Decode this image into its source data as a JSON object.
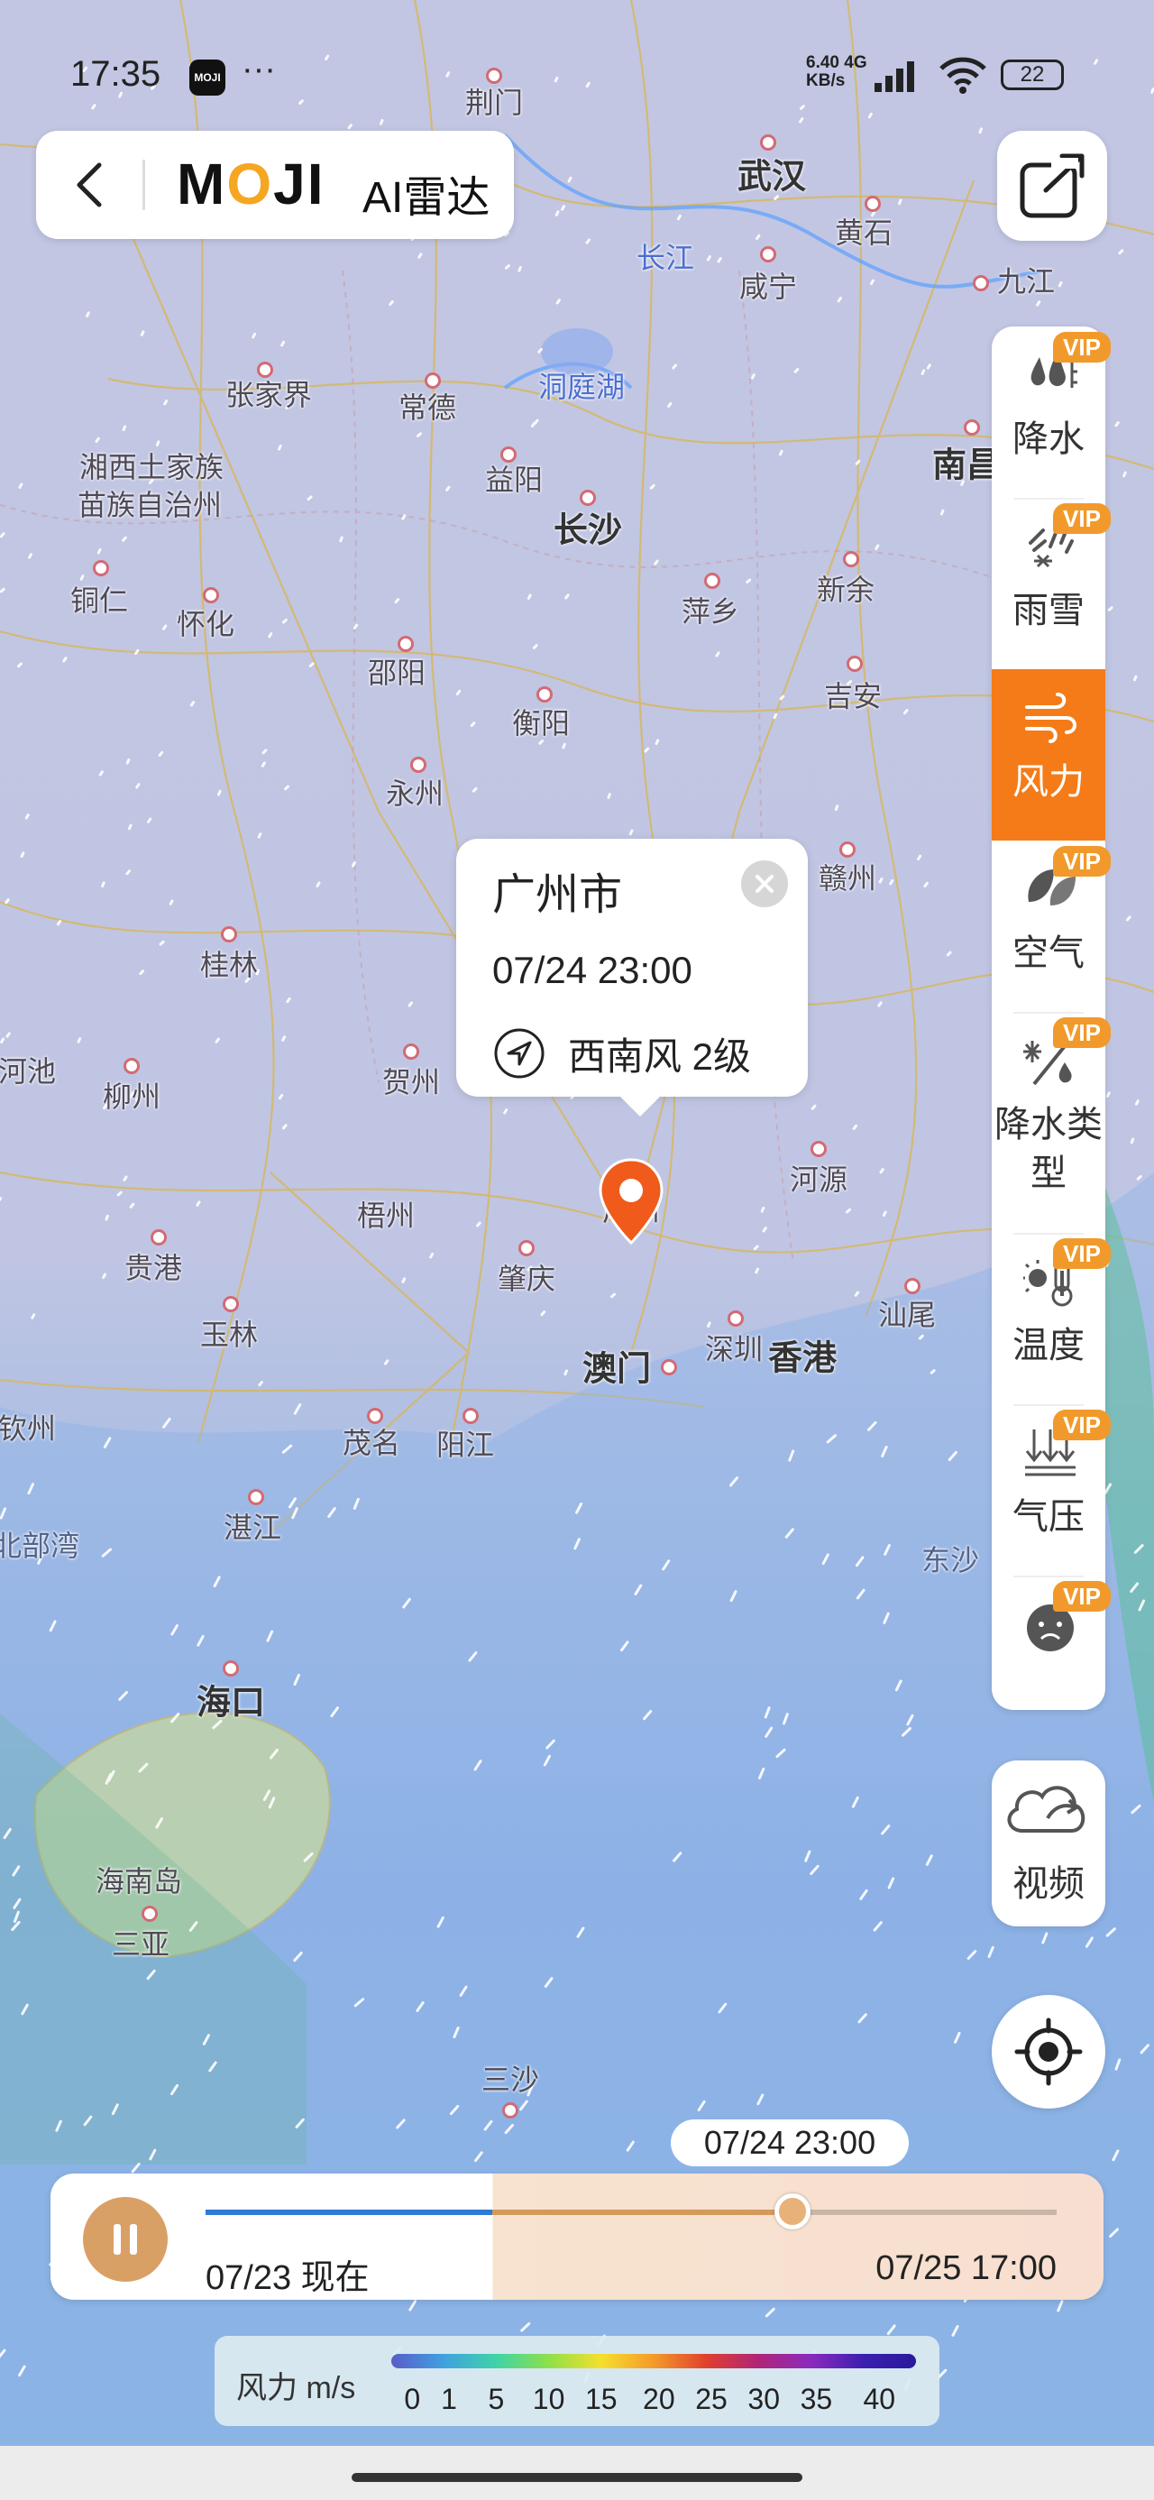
{
  "status_bar": {
    "time": "17:35",
    "app_icon_text": "MOJI",
    "more": "···",
    "net_speed_value": "6.40",
    "net_speed_unit": "KB/s",
    "net_type": "4G",
    "battery": "22"
  },
  "header": {
    "brand": "MOJI",
    "title": "AI雷达"
  },
  "layers": [
    {
      "label": "降水",
      "vip": "VIP",
      "icon": "precipitation-icon",
      "active": false
    },
    {
      "label": "雨雪",
      "vip": "VIP",
      "icon": "rain-snow-icon",
      "active": false
    },
    {
      "label": "风力",
      "vip": "",
      "icon": "wind-icon",
      "active": true
    },
    {
      "label": "空气",
      "vip": "VIP",
      "icon": "air-quality-icon",
      "active": false
    },
    {
      "label": "降水类型",
      "vip": "VIP",
      "icon": "precip-type-icon",
      "active": false
    },
    {
      "label": "温度",
      "vip": "VIP",
      "icon": "temperature-icon",
      "active": false
    },
    {
      "label": "气压",
      "vip": "VIP",
      "icon": "pressure-icon",
      "active": false
    },
    {
      "label": "",
      "vip": "VIP",
      "icon": "haze-icon",
      "active": false
    }
  ],
  "video_button": {
    "label": "视频",
    "icon": "cloud-video-icon"
  },
  "popup": {
    "city": "广州市",
    "time": "07/24 23:00",
    "wind": "西南风 2级"
  },
  "timeline": {
    "current_badge": "07/24 23:00",
    "start_label": "07/23 现在",
    "end_label": "07/25 17:00",
    "progress_fraction": 0.69
  },
  "legend": {
    "title": "风力 m/s",
    "ticks": [
      "0",
      "1",
      "5",
      "10",
      "15",
      "20",
      "25",
      "30",
      "35",
      "40"
    ]
  },
  "map": {
    "cities": [
      {
        "name": "荆门",
        "cls": ""
      },
      {
        "name": "武汉",
        "cls": "big"
      },
      {
        "name": "黄石",
        "cls": ""
      },
      {
        "name": "长江",
        "cls": "water"
      },
      {
        "name": "咸宁",
        "cls": ""
      },
      {
        "name": "九江",
        "cls": ""
      },
      {
        "name": "张家界",
        "cls": ""
      },
      {
        "name": "常德",
        "cls": ""
      },
      {
        "name": "洞庭湖",
        "cls": "water"
      },
      {
        "name": "湘西土家族",
        "cls": ""
      },
      {
        "name": "苗族自治州",
        "cls": ""
      },
      {
        "name": "益阳",
        "cls": ""
      },
      {
        "name": "长沙",
        "cls": "big"
      },
      {
        "name": "南昌",
        "cls": "big"
      },
      {
        "name": "铜仁",
        "cls": ""
      },
      {
        "name": "怀化",
        "cls": ""
      },
      {
        "name": "萍乡",
        "cls": ""
      },
      {
        "name": "新余",
        "cls": ""
      },
      {
        "name": "邵阳",
        "cls": ""
      },
      {
        "name": "吉安",
        "cls": ""
      },
      {
        "name": "衡阳",
        "cls": ""
      },
      {
        "name": "永州",
        "cls": ""
      },
      {
        "name": "赣州",
        "cls": ""
      },
      {
        "name": "桂林",
        "cls": ""
      },
      {
        "name": "河池",
        "cls": ""
      },
      {
        "name": "柳州",
        "cls": ""
      },
      {
        "name": "贺州",
        "cls": ""
      },
      {
        "name": "梧州",
        "cls": ""
      },
      {
        "name": "河源",
        "cls": ""
      },
      {
        "name": "贵港",
        "cls": ""
      },
      {
        "name": "肇庆",
        "cls": ""
      },
      {
        "name": "玉林",
        "cls": ""
      },
      {
        "name": "汕尾",
        "cls": ""
      },
      {
        "name": "澳门",
        "cls": "big"
      },
      {
        "name": "深圳",
        "cls": ""
      },
      {
        "name": "香港",
        "cls": "big"
      },
      {
        "name": "钦州",
        "cls": ""
      },
      {
        "name": "茂名",
        "cls": ""
      },
      {
        "name": "阳江",
        "cls": ""
      },
      {
        "name": "湛江",
        "cls": ""
      },
      {
        "name": "北部湾",
        "cls": "sea"
      },
      {
        "name": "东沙",
        "cls": "sea"
      },
      {
        "name": "海口",
        "cls": "big"
      },
      {
        "name": "海南岛",
        "cls": ""
      },
      {
        "name": "三亚",
        "cls": ""
      },
      {
        "name": "三沙",
        "cls": ""
      },
      {
        "name": "广州",
        "cls": ""
      }
    ]
  }
}
